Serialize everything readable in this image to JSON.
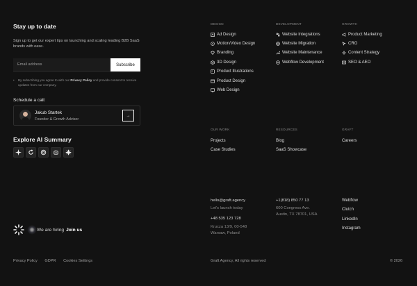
{
  "newsletter": {
    "title": "Stay up to date",
    "description": "Sign up to get our expert tips on launching and scaling leading B2B SaaS brands with ease.",
    "email_placeholder": "Email address",
    "subscribe_label": "Subscribe",
    "consent_prefix": "By subscribing you agree to with our ",
    "consent_link": "Privacy Policy",
    "consent_suffix": " and provide consent to receive updates from our company."
  },
  "schedule": {
    "title": "Schedule a call:",
    "name": "Jakub Startek",
    "role": "Founder & Growth Advisor",
    "button_glyph": "→"
  },
  "ai_summary": {
    "title": "Explore AI Summary",
    "buttons": [
      "sparkle-icon",
      "refresh-swirl-icon",
      "openai-icon",
      "robot-icon",
      "asterisk-burst-icon"
    ]
  },
  "hiring": {
    "text": "We are hiring",
    "link": "Join us"
  },
  "columns": {
    "design": {
      "heading": "Design",
      "items": [
        {
          "label": "Ad Design",
          "icon": "ad-icon"
        },
        {
          "label": "Motion/Video Design",
          "icon": "motion-icon"
        },
        {
          "label": "Branding",
          "icon": "branding-icon"
        },
        {
          "label": "3D Design",
          "icon": "cube-icon"
        },
        {
          "label": "Product Illustrations",
          "icon": "illustration-icon"
        },
        {
          "label": "Product Design",
          "icon": "product-design-icon"
        },
        {
          "label": "Web Design",
          "icon": "web-design-icon"
        }
      ]
    },
    "development": {
      "heading": "Development",
      "items": [
        {
          "label": "Website Integrations",
          "icon": "integrations-icon"
        },
        {
          "label": "Website Migration",
          "icon": "migration-icon"
        },
        {
          "label": "Website Maintenance",
          "icon": "wrench-icon"
        },
        {
          "label": "Webflow Development",
          "icon": "webflow-icon"
        }
      ]
    },
    "growth": {
      "heading": "Growth",
      "items": [
        {
          "label": "Product Marketing",
          "icon": "megaphone-icon"
        },
        {
          "label": "CRO",
          "icon": "cro-icon"
        },
        {
          "label": "Content Strategy",
          "icon": "content-icon"
        },
        {
          "label": "SEO & AEO",
          "icon": "seo-icon"
        }
      ]
    },
    "our_work": {
      "heading": "Our work",
      "items": [
        "Projects",
        "Case Studies"
      ]
    },
    "resources": {
      "heading": "Resources",
      "items": [
        "Blog",
        "SaaS Showcase"
      ]
    },
    "graft": {
      "heading": "Graft",
      "items": [
        "Careers"
      ]
    }
  },
  "contact": {
    "email": "hello@graft.agency",
    "email_note": "Let's launch today",
    "phone_pl": "+48 535 123 728",
    "address_pl_1": "Kruczа 13/9, 00-548",
    "address_pl_2": "Warsaw, Poland",
    "phone_us": "+1(818) 850 77 13",
    "address_us_1": "600 Congress Ave.",
    "address_us_2": "Austin, TX 78701, USA",
    "socials": [
      "Webflow",
      "Clutch",
      "LinkedIn",
      "Instagram"
    ]
  },
  "bottom": {
    "links": [
      "Privacy Policy",
      "GDPR",
      "Cookies Settings"
    ],
    "rights": "Graft Agency, All rights reserved",
    "copyright": "© 2026"
  },
  "colors": {
    "background": "#121212",
    "text": "#e9e9e9",
    "muted": "#8a8a8a",
    "button": "#ffffff"
  }
}
